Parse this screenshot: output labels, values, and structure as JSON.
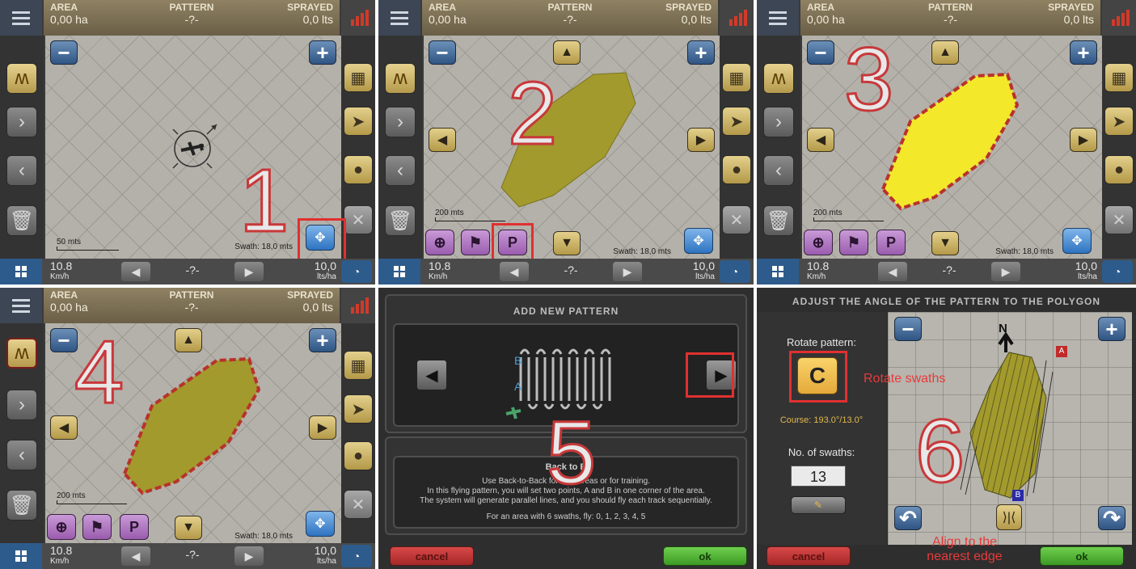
{
  "header": {
    "area_label": "AREA",
    "area_value": "0,00 ha",
    "pattern_label": "PATTERN",
    "pattern_value": "-?-",
    "sprayed_label": "SPRAYED",
    "sprayed_value": "0,0 lts"
  },
  "footer": {
    "speed": "10.8",
    "speed_unit": "Km/h",
    "nav_value": "-?-",
    "dose": "10,0",
    "dose_unit": "lts/ha"
  },
  "map": {
    "swath": "Swath: 18,0 mts",
    "scale_50": "50 mts",
    "scale_200": "200 mts"
  },
  "steps": [
    "1",
    "2",
    "3",
    "4",
    "5",
    "6"
  ],
  "dialog5": {
    "title": "ADD NEW PATTERN",
    "label_b": "B",
    "label_a": "A",
    "desc_title": "Back to B",
    "desc_line1": "Use Back-to-Back for V        ar areas or for training.",
    "desc_line2": "In this flying pattern, you will set two points, A and B in one corner of the area.",
    "desc_line3": "The system will generate parallel lines, and you should fly each track sequentially.",
    "desc_line4": "For an area with 6 swaths, fly:  0, 1, 2, 3, 4, 5",
    "cancel": "cancel",
    "ok": "ok"
  },
  "dialog6": {
    "title": "ADJUST THE ANGLE OF THE PATTERN TO THE POLYGON",
    "rotate_label": "Rotate pattern:",
    "course": "Course: 193.0°/13.0°",
    "swaths_label": "No. of swaths:",
    "swaths_value": "13",
    "north": "N",
    "marker_a": "A",
    "marker_b": "B",
    "annot_rotate": "Rotate swaths",
    "annot_align": "Align to the nearest edge",
    "cancel": "cancel",
    "ok": "ok"
  },
  "colors": {
    "highlight": "#e03030",
    "polygon": "#a29a2c",
    "polygon_selected": "#f3e82a",
    "edge": "#b8322c"
  }
}
